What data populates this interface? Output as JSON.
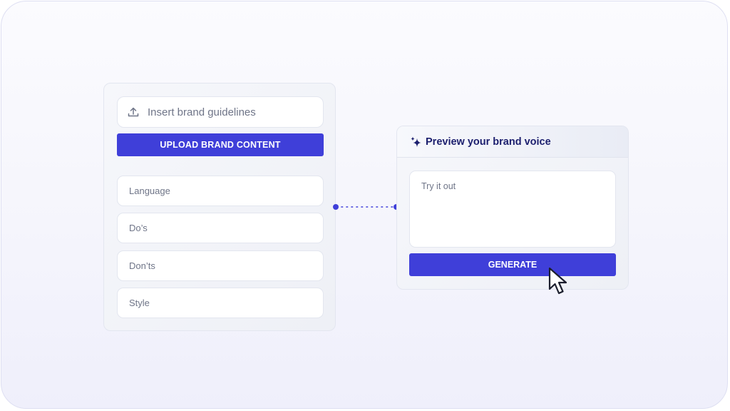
{
  "left_panel": {
    "upload_placeholder": "Insert brand guidelines",
    "upload_button": "UPLOAD BRAND CONTENT",
    "fields": [
      "Language",
      "Do’s",
      "Don’ts",
      "Style"
    ]
  },
  "right_panel": {
    "title": "Preview your brand voice",
    "input_placeholder": "Try it out",
    "generate_button": "GENERATE"
  },
  "icons": {
    "upload": "upload-icon",
    "sparkle": "sparkle-icon",
    "cursor": "mouse-pointer-icon"
  },
  "colors": {
    "accent": "#3f3fd9",
    "title": "#1c1f6e",
    "muted_text": "#6f7588"
  }
}
